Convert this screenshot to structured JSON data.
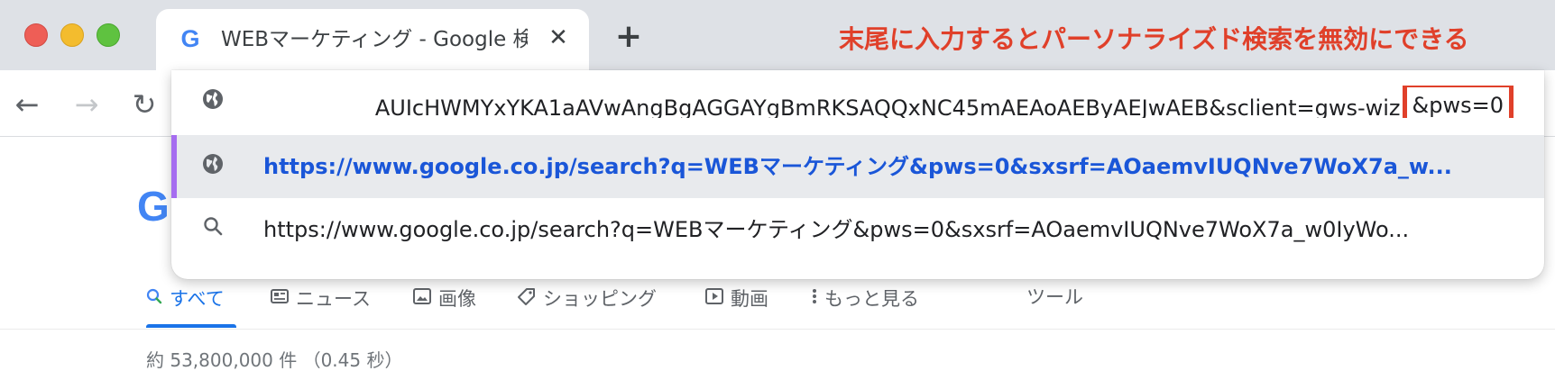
{
  "tab": {
    "favicon": "G",
    "title": "WEBマーケティング - Google 検索",
    "close_glyph": "✕"
  },
  "new_tab_glyph": "+",
  "annotation": "末尾に入力するとパーソナライズド検索を無効にできる",
  "toolbar": {
    "back_glyph": "←",
    "forward_glyph": "→",
    "reload_glyph": "↻"
  },
  "omnibox": {
    "input_text": "AUIcHWMYxYKA1aAVwAngBgAGGAYgBmRKSAQQxNC45mAEAoAEByAEJwAEB&sclient=gws-wiz",
    "highlighted_text": "&pws=0",
    "suggestions": [
      {
        "icon": "globe-icon",
        "text": "https://www.google.co.jp/search?q=WEBマーケティング&pws=0&sxsrf=AOaemvIUQNve7WoX7a_w..."
      },
      {
        "icon": "search-icon",
        "text": "https://www.google.co.jp/search?q=WEBマーケティング&pws=0&sxsrf=AOaemvIUQNve7WoX7a_w0IyWo..."
      }
    ]
  },
  "page": {
    "logo_letter": "G",
    "result_tabs": [
      {
        "label": "すべて",
        "icon": "search-icon",
        "active": true
      },
      {
        "label": "ニュース",
        "icon": "news-icon"
      },
      {
        "label": "画像",
        "icon": "image-icon"
      },
      {
        "label": "ショッピング",
        "icon": "tag-icon"
      },
      {
        "label": "動画",
        "icon": "play-icon"
      },
      {
        "label": "もっと見る",
        "icon": "more-vert-icon"
      }
    ],
    "tools_label": "ツール",
    "result_stats": "約 53,800,000 件 （0.45 秒）"
  },
  "colors": {
    "annotation": "#e0402a",
    "accent_bar": "#a66df0",
    "link_blue": "#1a56d8",
    "active_tab": "#1a73e8"
  }
}
